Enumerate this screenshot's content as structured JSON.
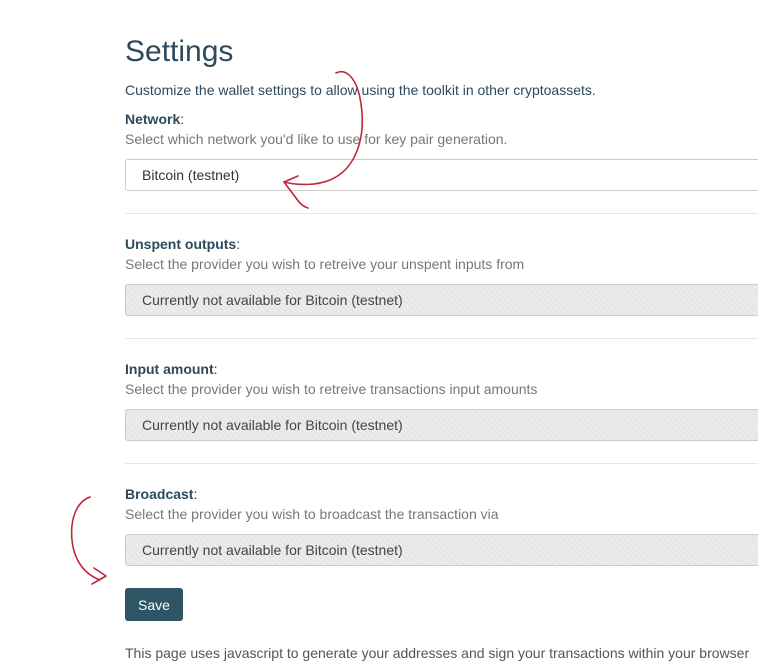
{
  "page": {
    "title": "Settings",
    "description": "Customize the wallet settings to allow using the toolkit in other cryptoassets."
  },
  "sections": {
    "network": {
      "label": "Network",
      "help": "Select which network you'd like to use for key pair generation.",
      "value": "Bitcoin (testnet)"
    },
    "unspent_outputs": {
      "label": "Unspent outputs",
      "help": "Select the provider you wish to retreive your unspent inputs from",
      "value": "Currently not available for Bitcoin (testnet)"
    },
    "input_amount": {
      "label": "Input amount",
      "help": "Select the provider you wish to retreive transactions input amounts",
      "value": "Currently not available for Bitcoin (testnet)"
    },
    "broadcast": {
      "label": "Broadcast",
      "help": "Select the provider you wish to broadcast the transaction via",
      "value": "Currently not available for Bitcoin (testnet)"
    }
  },
  "actions": {
    "save_label": "Save"
  },
  "footer": {
    "note": "This page uses javascript to generate your addresses and sign your transactions within your browser"
  },
  "colors": {
    "title": "#2c4a5c",
    "button": "#2e5566",
    "annotation": "#c0283a"
  }
}
